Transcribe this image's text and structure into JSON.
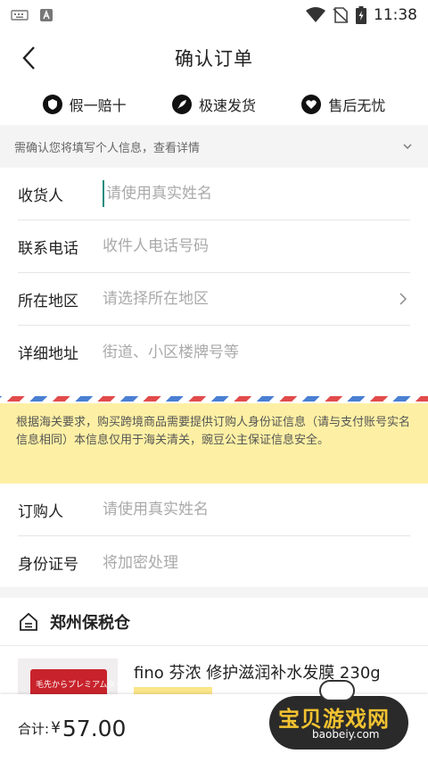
{
  "status_bar": {
    "time": "11:38",
    "icons": [
      "keyboard-icon",
      "app-a-icon",
      "wifi-icon",
      "no-sim-icon",
      "battery-charging-icon"
    ]
  },
  "header": {
    "title": "确认订单",
    "back_icon": "chevron-left-icon"
  },
  "guarantees": [
    {
      "label": "假一赔十",
      "icon": "shield-icon"
    },
    {
      "label": "极速发货",
      "icon": "rocket-icon"
    },
    {
      "label": "售后无忧",
      "icon": "heart-icon"
    }
  ],
  "notice": {
    "text": "需确认您将填写个人信息，查看详情",
    "icon": "chevron-down-icon"
  },
  "address_form": {
    "recipient": {
      "label": "收货人",
      "placeholder": "请使用真实姓名",
      "value": ""
    },
    "phone": {
      "label": "联系电话",
      "placeholder": "收件人电话号码",
      "value": ""
    },
    "region": {
      "label": "所在地区",
      "placeholder": "请选择所在地区",
      "value": ""
    },
    "address": {
      "label": "详细地址",
      "placeholder": "街道、小区楼牌号等",
      "value": ""
    }
  },
  "customs_notice": "根据海关要求，购买跨境商品需要提供订购人身份证信息（请与支付账号实名信息相同）本信息仅用于海关清关，豌豆公主保证信息安全。",
  "buyer_form": {
    "name": {
      "label": "订购人",
      "placeholder": "请使用真实姓名",
      "value": ""
    },
    "id_card": {
      "label": "身份证号",
      "placeholder": "将加密处理",
      "value": ""
    }
  },
  "warehouse": {
    "name": "郑州保税仓",
    "icon": "house-icon"
  },
  "product": {
    "name": "fino 芬浓 修护滋润补水发膜 230g",
    "thumb_text": "毛先からプレミアムタッチ"
  },
  "total": {
    "label": "合计:",
    "currency": "¥",
    "value": "57.00"
  },
  "watermark": {
    "title": "宝贝游戏网",
    "url": "baobeiy.com"
  },
  "colors": {
    "accent_cursor": "#1a8c7c",
    "notice_bg": "#fdf0a4",
    "airmail_red": "#e24b4b",
    "airmail_blue": "#4a7fd3"
  }
}
